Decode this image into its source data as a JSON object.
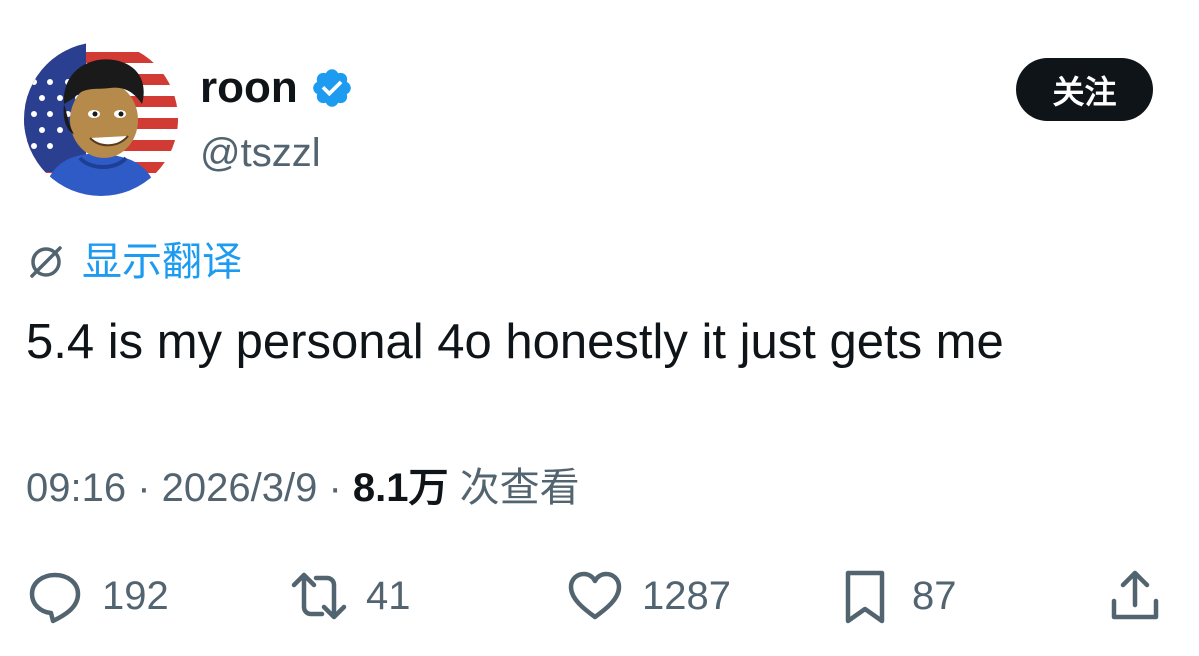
{
  "author": {
    "display_name": "roon",
    "handle": "@tszzl",
    "verified": true
  },
  "follow_button": {
    "label": "关注"
  },
  "translate_link": {
    "label": "显示翻译"
  },
  "tweet": {
    "text": "5.4 is my personal 4o honestly it just gets me"
  },
  "meta": {
    "time": "09:16",
    "separator": " · ",
    "date": "2026/3/9",
    "views_count": "8.1万",
    "views_label": " 次查看"
  },
  "actions": {
    "replies": "192",
    "reposts": "41",
    "likes": "1287",
    "bookmarks": "87"
  },
  "colors": {
    "accent": "#1d9bf0",
    "secondary_text": "#536471",
    "primary_text": "#0f1419",
    "button_bg": "#0f1419"
  },
  "icons": {
    "verified": "verified-badge-icon",
    "translate": "globe-icon",
    "reply": "reply-icon",
    "repost": "repost-icon",
    "like": "heart-icon",
    "bookmark": "bookmark-icon",
    "share": "share-icon"
  }
}
